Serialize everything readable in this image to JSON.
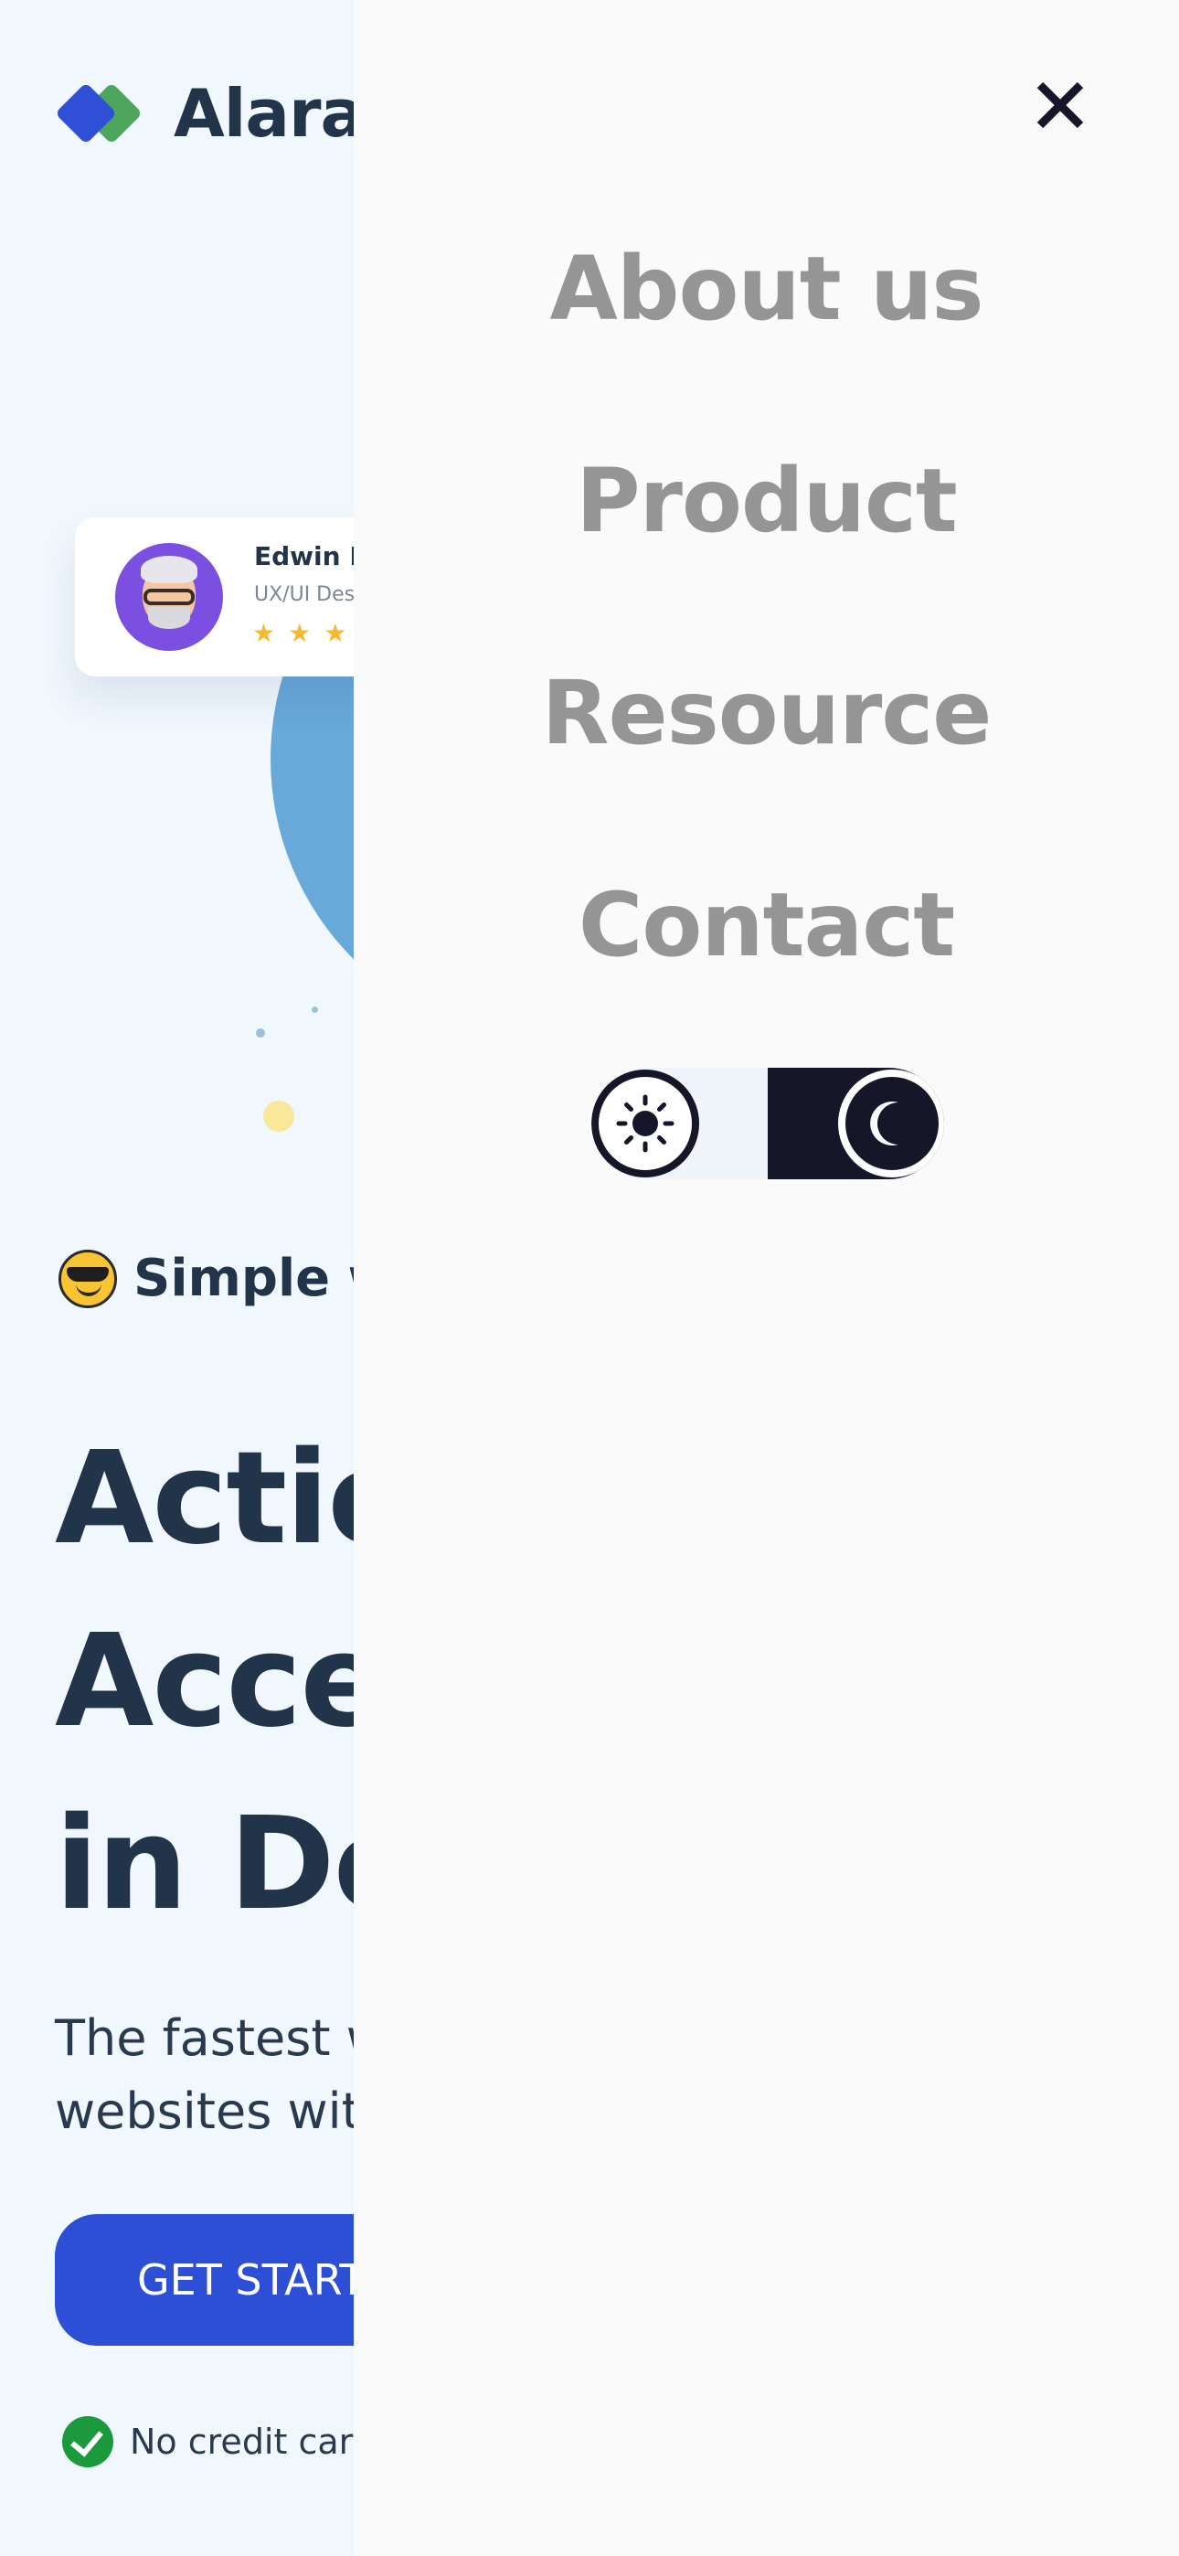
{
  "brand": {
    "name": "Alara"
  },
  "profile_card": {
    "name": "Edwin M",
    "role": "UX/UI Des",
    "stars": "★★★"
  },
  "hero": {
    "tagline": "Simple w",
    "headline": [
      "Actio",
      "Acce",
      "in De"
    ],
    "subtext": [
      "The fastest w",
      "websites wit"
    ],
    "cta_label": "GET START",
    "note": "No credit card"
  },
  "drawer": {
    "nav": [
      {
        "label": "About us"
      },
      {
        "label": "Product"
      },
      {
        "label": "Resource"
      },
      {
        "label": "Contact"
      }
    ],
    "theme_toggle": {
      "selected": "dark"
    }
  },
  "icons": {
    "close": "close-icon",
    "sun": "sun-icon",
    "moon": "moon-icon",
    "check": "check-circle-icon",
    "emoji": "sunglasses-emoji-icon"
  },
  "colors": {
    "page_bg": "#f0f7fd",
    "drawer_bg": "#fafafa",
    "nav_text": "#959595",
    "primary": "#2d4fd5",
    "logo_blue": "#2f4fd6",
    "logo_green": "#4ea65e",
    "dark": "#151628",
    "heading": "#22344a",
    "accent_circle": "#68a9d9",
    "star": "#f6b934",
    "success": "#1a9a3d"
  }
}
